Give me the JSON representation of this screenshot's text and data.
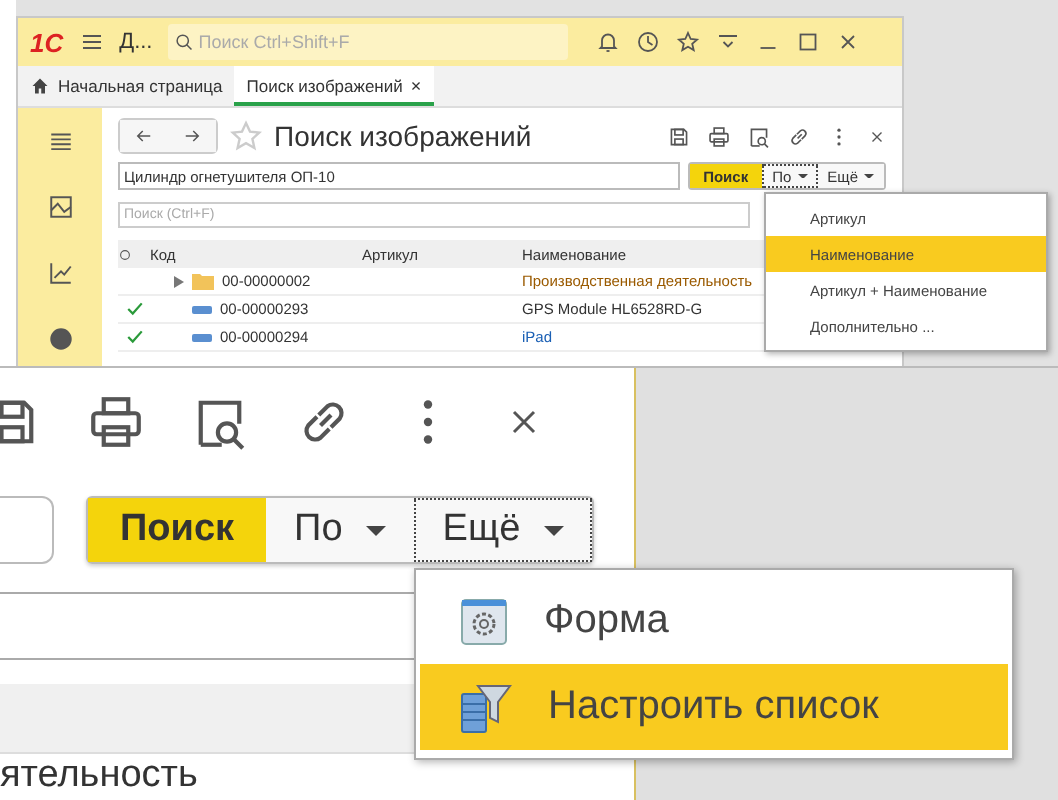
{
  "window": {
    "logo": "1С",
    "app_menu": "Д...",
    "search": {
      "placeholder": "Поиск Ctrl+Shift+F"
    }
  },
  "tabs": [
    {
      "label": "Начальная страница",
      "selected": false,
      "kind": "home"
    },
    {
      "label": "Поиск изображений",
      "selected": true,
      "kind": "form",
      "close": "×"
    }
  ],
  "form": {
    "title": "Поиск изображений",
    "query": "Цилиндр огнетушителя ОП-10",
    "search_button": "Поиск",
    "by_button": "По",
    "more_button": "Ещё",
    "filter": {
      "placeholder": "Поиск (Ctrl+F)"
    }
  },
  "table": {
    "columns": [
      "Код",
      "Артикул",
      "Наименование"
    ],
    "rows": [
      {
        "kind": "folder",
        "checked": false,
        "code": "00-00000002",
        "name": "Производственная деятельность",
        "color": "#9a5a00"
      },
      {
        "kind": "item",
        "checked": true,
        "code": "00-00000293",
        "name": "GPS Module HL6528RD-G",
        "color": "#333333"
      },
      {
        "kind": "item",
        "checked": true,
        "code": "00-00000294",
        "name": "iPad",
        "color": "#1a5fb4"
      }
    ]
  },
  "by_menu": {
    "items": [
      {
        "label": "Артикул",
        "selected": false
      },
      {
        "label": "Наименование",
        "selected": true
      },
      {
        "label": "Артикул + Наименование",
        "selected": false
      },
      {
        "label": "Дополнительно ...",
        "selected": false
      }
    ]
  },
  "zoom": {
    "search_button": "Поиск",
    "by_button": "По",
    "more_button": "Ещё",
    "menu": [
      {
        "label": "Форма",
        "kind": "form",
        "selected": false
      },
      {
        "label": "Настроить список",
        "kind": "list-settings",
        "selected": true
      }
    ],
    "row_text": "ятельность"
  }
}
